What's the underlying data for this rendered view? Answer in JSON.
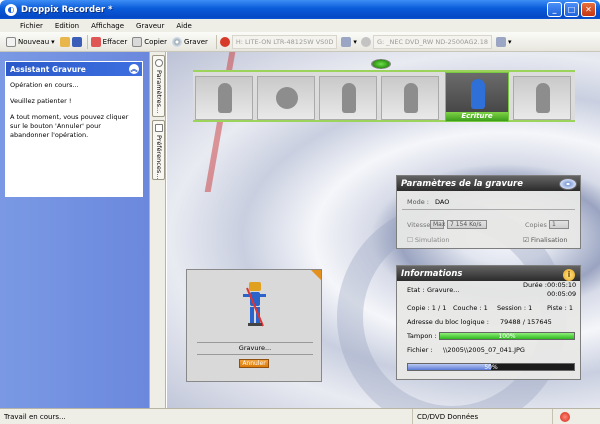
{
  "window": {
    "title": "Droppix Recorder *"
  },
  "menu": [
    "Fichier",
    "Edition",
    "Affichage",
    "Graveur",
    "Aide"
  ],
  "toolbar": {
    "nouveau": "Nouveau",
    "effacer": "Effacer",
    "copier": "Copier",
    "graver": "Graver",
    "drive1": "H: LITE-ON LTR-48125W  VS0D",
    "drive2": "G: _NEC  DVD_RW ND-2500AG2.18"
  },
  "assistant": {
    "title": "Assistant Gravure",
    "line1": "Opération en cours...",
    "line2": "Veuillez patienter !",
    "line3": "A tout moment, vous pouvez cliquer sur le bouton 'Annuler' pour abandonner l'opération."
  },
  "side_tabs": {
    "params": "Paramètres...",
    "prefs": "Préférences..."
  },
  "steps": {
    "active_label": "Ecriture"
  },
  "burn_params": {
    "title": "Paramètres de la gravure",
    "mode_label": "Mode :",
    "mode_value": "DAO",
    "speed_label": "Vitesse",
    "speed_value": "Max",
    "speed_kbs": "7 154 Ko/s",
    "copies_label": "Copies",
    "copies_value": "1",
    "simulation": "Simulation",
    "finalisation": "Finalisation"
  },
  "burn_box": {
    "status": "Gravure...",
    "cancel": "Annuler"
  },
  "info": {
    "title": "Informations",
    "etat_label": "Etat :",
    "etat_value": "Gravure...",
    "duree_label": "Durée :",
    "duree1": "00:05:10",
    "duree2": "00:05:09",
    "copie": "Copie : 1 / 1",
    "couche": "Couche : 1",
    "session": "Session : 1",
    "piste": "Piste : 1",
    "adresse_label": "Adresse du bloc logique :",
    "adresse_value": "79488 / 157645",
    "tampon_label": "Tampon :",
    "tampon_text": "100%",
    "tampon_pct": 100,
    "fichier_label": "Fichier :",
    "fichier_value": "\\\\2005\\\\2005_07_041.JPG",
    "progress_text": "50%",
    "progress_pct": 50
  },
  "status": {
    "left": "Travail en cours...",
    "middle": "CD/DVD Données"
  },
  "colors": {
    "accent": "#0a5bd9",
    "progress_green": "#3ec92e",
    "progress_blue": "#6f8fe2",
    "cancel_orange": "#e08a18"
  }
}
